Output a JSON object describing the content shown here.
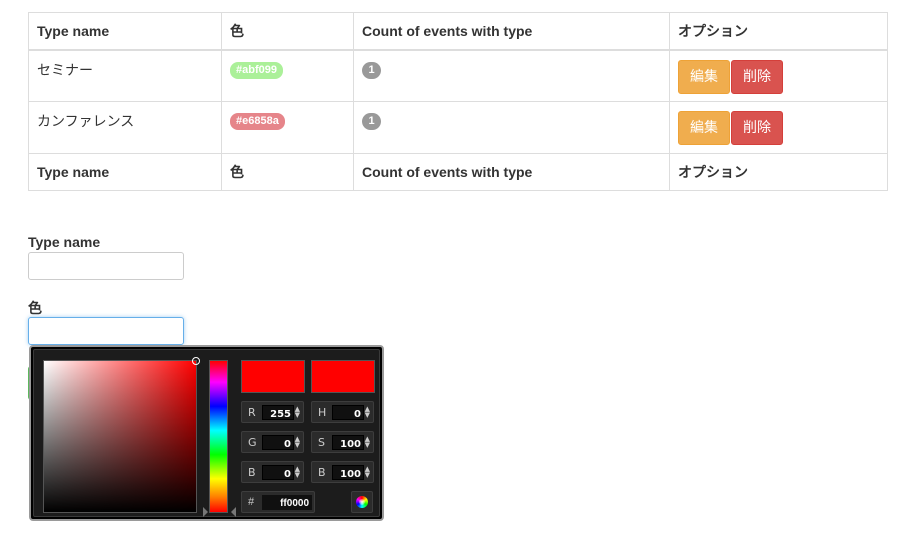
{
  "table": {
    "headers": [
      "Type name",
      "色",
      "Count of events with type",
      "オプション"
    ],
    "rows": [
      {
        "name": "セミナー",
        "color": "#abf099",
        "count": "1",
        "edit": "編集",
        "delete": "削除"
      },
      {
        "name": "カンファレンス",
        "color": "#e6858a",
        "count": "1",
        "edit": "編集",
        "delete": "削除"
      }
    ]
  },
  "form": {
    "type_name_label": "Type name",
    "type_name_value": "",
    "color_label": "色",
    "color_value": ""
  },
  "color_picker": {
    "new_color": "#ff0000",
    "current_color": "#ff0000",
    "r_label": "R",
    "r": "255",
    "g_label": "G",
    "g": "0",
    "b_label": "B",
    "b": "0",
    "h_label": "H",
    "h": "0",
    "s_label": "S",
    "s": "100",
    "v_label": "B",
    "v": "100",
    "hex_label": "#",
    "hex": "ff0000"
  },
  "colors": {
    "edit_button": "#f0ad4e",
    "delete_button": "#d9534f",
    "badge": "#999999"
  }
}
